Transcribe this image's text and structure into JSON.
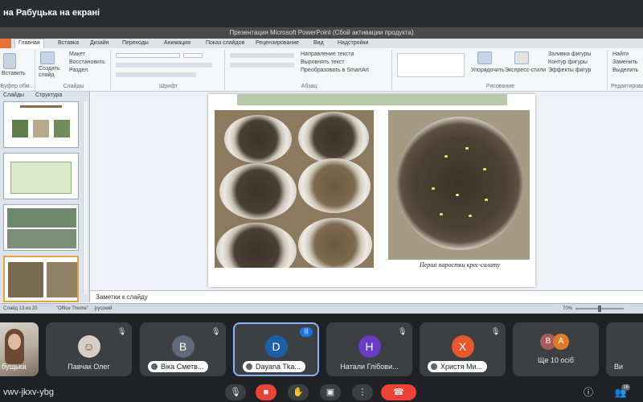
{
  "meet": {
    "presenting_banner": "на Рабуцька на екрані",
    "meeting_code": "vwv-jkxv-ybg",
    "participants": [
      {
        "name": "Павчак Олег",
        "initial": "",
        "color": "#3c4043",
        "muted": true,
        "style": "photo"
      },
      {
        "name": "Віка Сметв...",
        "initial": "В",
        "color": "#5f6b7a",
        "muted": true,
        "style": "pill"
      },
      {
        "name": "Dayana Tka...",
        "initial": "D",
        "color": "#1a5fa8",
        "muted": false,
        "style": "pill",
        "speaking": true
      },
      {
        "name": "Натали Глібови...",
        "initial": "Н",
        "color": "#6a3cc4",
        "muted": true,
        "style": "plain"
      },
      {
        "name": "Христя Ми...",
        "initial": "Х",
        "color": "#e8582c",
        "muted": true,
        "style": "pill"
      },
      {
        "name": "Ще 10 осіб",
        "initial": "",
        "color": "#3c4043",
        "muted": false,
        "style": "plain"
      },
      {
        "name": "Ви",
        "initial": "",
        "color": "#3c4043",
        "muted": false,
        "style": "plain"
      }
    ],
    "self_name": "бущька",
    "more_avatars": [
      "В",
      "А"
    ],
    "people_count": "16"
  },
  "ppt": {
    "window_title": "Презентация Microsoft PowerPoint (Сбой активации продукта)",
    "tabs": [
      "Главная",
      "Вставка",
      "Дизайн",
      "Переходы",
      "Анимация",
      "Показ слайдов",
      "Рецензирование",
      "Вид",
      "Надстройки"
    ],
    "active_tab": "Главная",
    "groups": {
      "clipboard": "Буфер обм...",
      "slides": "Слайды",
      "font": "Шрифт",
      "paragraph": "Абзац",
      "drawing": "Рисование",
      "editing": "Редактирование"
    },
    "buttons": {
      "paste": "Вставить",
      "create_slide": "Создать слайд",
      "layout": "Макет",
      "reset": "Восстановить",
      "section": "Раздел",
      "text_direction": "Направление текста",
      "align_text": "Выровнять текст",
      "smartart": "Преобразовать в SmartArt",
      "arrange": "Упорядочить",
      "quick_styles": "Экспресс-стили",
      "shape_fill": "Заливка фигуры",
      "shape_outline": "Контур фигуры",
      "shape_effects": "Эффекты фигур",
      "find": "Найти",
      "replace": "Заменить",
      "select": "Выделить"
    },
    "pane_tabs": [
      "Слайды",
      "Структура"
    ],
    "notes_placeholder": "Заметки к слайду",
    "status": {
      "slide_of": "Слайд 13 из 20",
      "theme": "\"Office Theme\"",
      "lang": "русский",
      "zoom": "70%"
    },
    "slide": {
      "caption": "Перші паростки крес-салату"
    }
  }
}
